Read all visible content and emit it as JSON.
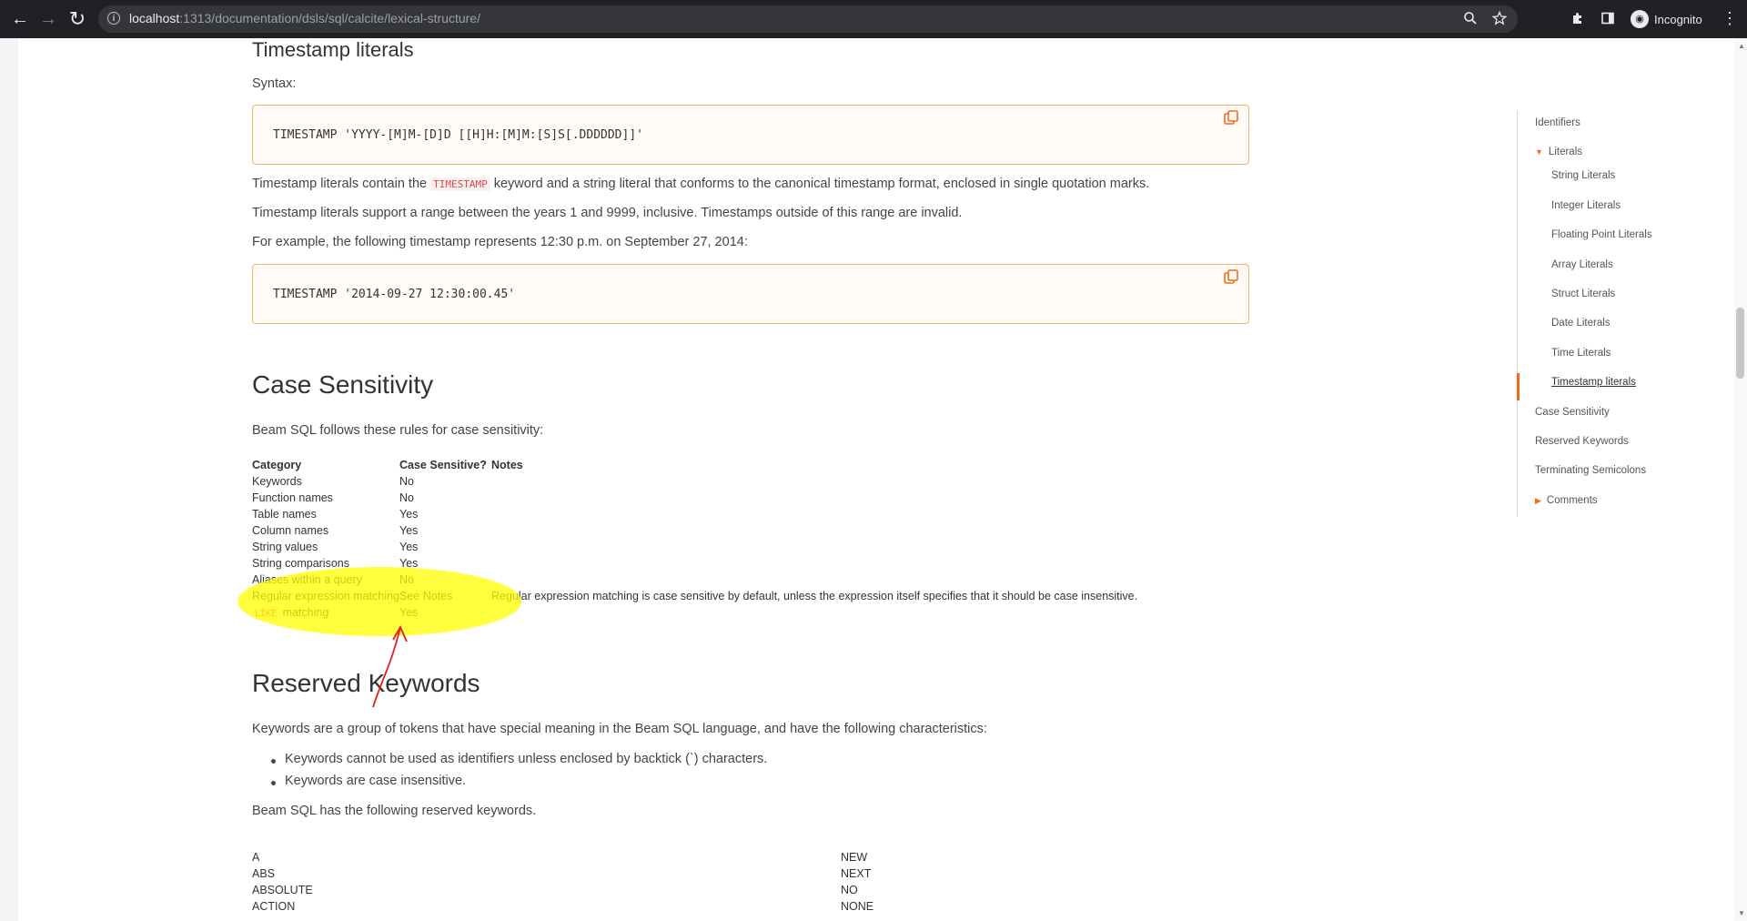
{
  "browser": {
    "url_host": "localhost",
    "url_rest": ":1313/documentation/dsls/sql/calcite/lexical-structure/",
    "profile_label": "Incognito"
  },
  "content": {
    "timestamp_title": "Timestamp literals",
    "syntax_label": "Syntax:",
    "syntax_code": "TIMESTAMP 'YYYY-[M]M-[D]D [[H]H:[M]M:[S]S[.DDDDDD]]'",
    "ts_p1_before": "Timestamp literals contain the ",
    "ts_p1_code": "TIMESTAMP",
    "ts_p1_after": " keyword and a string literal that conforms to the canonical timestamp format, enclosed in single quotation marks.",
    "ts_p2": "Timestamp literals support a range between the years 1 and 9999, inclusive. Timestamps outside of this range are invalid.",
    "ts_p3": "For example, the following timestamp represents 12:30 p.m. on September 27, 2014:",
    "example_code": "TIMESTAMP '2014-09-27 12:30:00.45'",
    "case_title": "Case Sensitivity",
    "case_intro": "Beam SQL follows these rules for case sensitivity:",
    "table": {
      "headers": [
        "Category",
        "Case Sensitive?",
        "Notes"
      ],
      "rows": [
        {
          "category": "Keywords",
          "sensitive": "No",
          "notes": ""
        },
        {
          "category": "Function names",
          "sensitive": "No",
          "notes": ""
        },
        {
          "category": "Table names",
          "sensitive": "Yes",
          "notes": ""
        },
        {
          "category": "Column names",
          "sensitive": "Yes",
          "notes": ""
        },
        {
          "category": "String values",
          "sensitive": "Yes",
          "notes": ""
        },
        {
          "category": "String comparisons",
          "sensitive": "Yes",
          "notes": ""
        },
        {
          "category": "Aliases within a query",
          "sensitive": "No",
          "notes": ""
        },
        {
          "category": "Regular expression matching",
          "sensitive": "See Notes",
          "notes": "Regular expression matching is case sensitive by default, unless the expression itself specifies that it should be case insensitive."
        },
        {
          "category_code": "LIKE",
          "category": " matching",
          "sensitive": "Yes",
          "notes": ""
        }
      ]
    },
    "reserved_title": "Reserved Keywords",
    "reserved_intro": "Keywords are a group of tokens that have special meaning in the Beam SQL language, and have the following characteristics:",
    "reserved_bullets": [
      "Keywords cannot be used as identifiers unless enclosed by backtick (`) characters.",
      "Keywords are case insensitive."
    ],
    "reserved_outro": "Beam SQL has the following reserved keywords.",
    "keywords_left": [
      "A",
      "ABS",
      "ABSOLUTE",
      "ACTION"
    ],
    "keywords_right": [
      "NEW",
      "NEXT",
      "NO",
      "NONE"
    ]
  },
  "toc": {
    "items": [
      "Identifiers",
      "Literals",
      "String Literals",
      "Integer Literals",
      "Floating Point Literals",
      "Array Literals",
      "Struct Literals",
      "Date Literals",
      "Time Literals",
      "Timestamp literals",
      "Case Sensitivity",
      "Reserved Keywords",
      "Terminating Semicolons",
      "Comments"
    ],
    "active": "Timestamp literals"
  },
  "colors": {
    "accent": "#f26b1d",
    "code_border": "#f2b36c",
    "highlight": "#ffff00",
    "annotation_arrow": "#e02020"
  },
  "icons": [
    "back-arrow-icon",
    "forward-arrow-icon",
    "reload-icon",
    "info-icon",
    "zoom-icon",
    "star-icon",
    "puzzle-icon",
    "sidepanel-icon",
    "incognito-icon",
    "kebab-menu-icon",
    "copy-icon"
  ]
}
